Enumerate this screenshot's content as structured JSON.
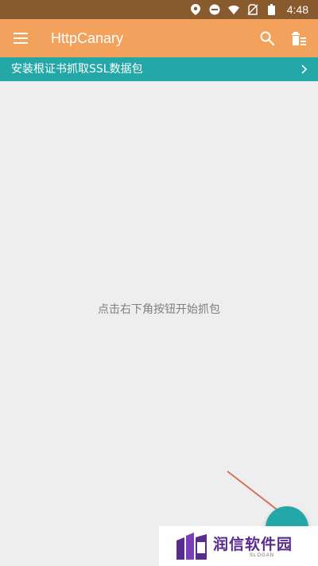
{
  "status_bar": {
    "time": "4:48",
    "icons": [
      "location-icon",
      "dnd-icon",
      "wifi-icon",
      "no-sim-icon",
      "battery-icon"
    ]
  },
  "app_bar": {
    "title": "HttpCanary",
    "icons": [
      "menu-icon",
      "search-icon",
      "clear-icon"
    ]
  },
  "banner": {
    "text": "安装根证书抓取SSL数据包"
  },
  "empty_state": {
    "hint": "点击右下角按钮开始抓包"
  },
  "watermark": {
    "title": "润信软件园",
    "subtitle": "SLOGAN"
  },
  "colors": {
    "status_bar": "#8a5a2f",
    "app_bar": "#f3a25e",
    "banner": "#24a7a7",
    "background": "#eeeeee",
    "annotation_arrow": "#d0755b",
    "watermark_text": "#5a2b8f"
  }
}
